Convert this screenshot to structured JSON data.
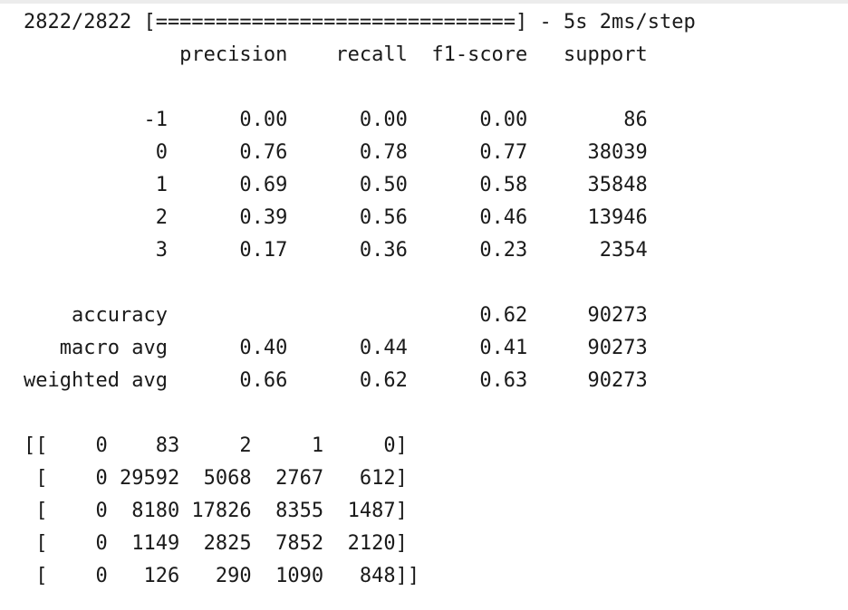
{
  "progress": {
    "line": "2822/2822 [==============================] - 5s 2ms/step"
  },
  "report": {
    "headers": [
      "precision",
      "recall",
      "f1-score",
      "support"
    ],
    "rows": [
      {
        "label": "-1",
        "precision": "0.00",
        "recall": "0.00",
        "f1": "0.00",
        "support": "86"
      },
      {
        "label": "0",
        "precision": "0.76",
        "recall": "0.78",
        "f1": "0.77",
        "support": "38039"
      },
      {
        "label": "1",
        "precision": "0.69",
        "recall": "0.50",
        "f1": "0.58",
        "support": "35848"
      },
      {
        "label": "2",
        "precision": "0.39",
        "recall": "0.56",
        "f1": "0.46",
        "support": "13946"
      },
      {
        "label": "3",
        "precision": "0.17",
        "recall": "0.36",
        "f1": "0.23",
        "support": "2354"
      }
    ],
    "summary": [
      {
        "label": "accuracy",
        "precision": "",
        "recall": "",
        "f1": "0.62",
        "support": "90273"
      },
      {
        "label": "macro avg",
        "precision": "0.40",
        "recall": "0.44",
        "f1": "0.41",
        "support": "90273"
      },
      {
        "label": "weighted avg",
        "precision": "0.66",
        "recall": "0.62",
        "f1": "0.63",
        "support": "90273"
      }
    ]
  },
  "confusion_matrix": [
    [
      0,
      83,
      2,
      1,
      0
    ],
    [
      0,
      29592,
      5068,
      2767,
      612
    ],
    [
      0,
      8180,
      17826,
      8355,
      1487
    ],
    [
      0,
      1149,
      2825,
      7852,
      2120
    ],
    [
      0,
      126,
      290,
      1090,
      848
    ]
  ]
}
